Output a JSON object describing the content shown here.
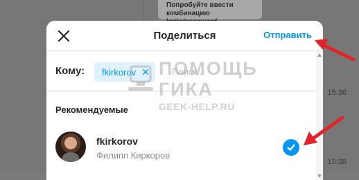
{
  "background": {
    "message_hint": "Попробуйте ввести комбинацию login/password",
    "times": [
      "15:36",
      "15:38"
    ]
  },
  "modal": {
    "title": "Поделиться",
    "send_label": "Отправить",
    "to_label": "Кому:",
    "selected_chip": "fkirkorov",
    "search_placeholder": "Поиск...",
    "section_label": "Рекомендуемые"
  },
  "suggestions": [
    {
      "username": "fkirkorov",
      "full_name": "Филипп Киркоров",
      "selected": true
    }
  ],
  "watermark": {
    "line1": "ПОМОЩЬ",
    "line2": "ГИКА",
    "line3": "GEEK-HELP.RU"
  },
  "colors": {
    "accent": "#0095f6",
    "chip_bg": "#e0f1ff",
    "annotation_arrow": "#e2232a"
  },
  "icons": {
    "close": "close-icon",
    "chip_remove": "remove-chip-icon",
    "selected": "checkmark-icon"
  }
}
